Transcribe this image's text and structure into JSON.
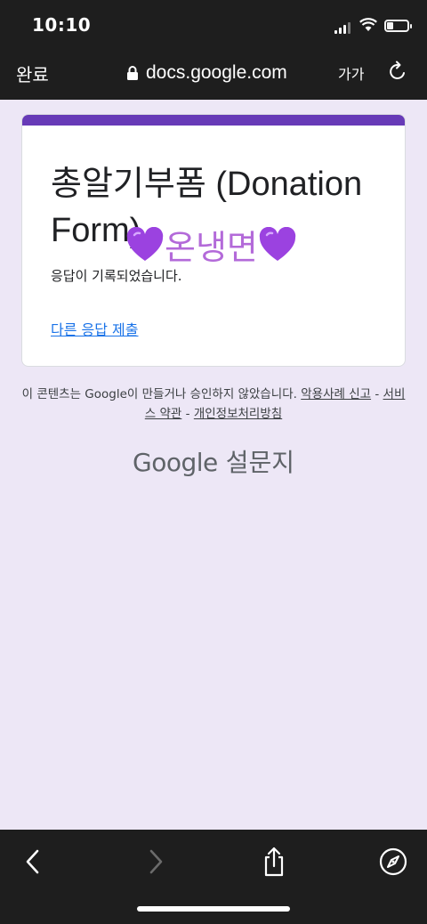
{
  "status_bar": {
    "time": "10:10"
  },
  "browser": {
    "done_label": "완료",
    "url": "docs.google.com",
    "text_size_label": "가가"
  },
  "form": {
    "accent_color": "#673ab7",
    "title": "총알기부폼 (Donation Form)",
    "title_overlay": "온냉면",
    "response_message": "응답이 기록되었습니다.",
    "another_response_link": "다른 응답 제출"
  },
  "footer": {
    "disclaimer_text": "이 콘텐츠는 Google이 만들거나 승인하지 않았습니다.",
    "report_abuse_link": "악용사례 신고",
    "separator": "-",
    "terms_link": "서비스 약관",
    "privacy_link": "개인정보처리방침",
    "brand_google": "Google",
    "brand_forms": "설문지"
  },
  "toolbar": {
    "icons": [
      "back-icon",
      "forward-icon",
      "share-icon",
      "compass-icon"
    ]
  }
}
